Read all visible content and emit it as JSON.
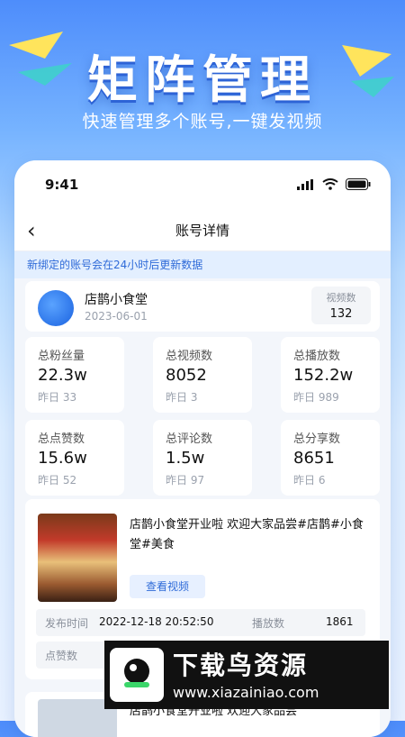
{
  "hero": {
    "title": "矩阵管理",
    "subtitle": "快速管理多个账号,一键发视频"
  },
  "status_bar": {
    "time": "9:41"
  },
  "navbar": {
    "title": "账号详情",
    "back_icon": "chevron-left-icon"
  },
  "notice": "新绑定的账号会在24小时后更新数据",
  "account": {
    "name": "店鹊小食堂",
    "date": "2023-06-01",
    "video_count_label": "视频数",
    "video_count": "132"
  },
  "stats": [
    {
      "label": "总粉丝量",
      "value": "22.3w",
      "sub": "昨日 33"
    },
    {
      "label": "总视频数",
      "value": "8052",
      "sub": "昨日 3"
    },
    {
      "label": "总播放数",
      "value": "152.2w",
      "sub": "昨日 989"
    },
    {
      "label": "总点赞数",
      "value": "15.6w",
      "sub": "昨日 52"
    },
    {
      "label": "总评论数",
      "value": "1.5w",
      "sub": "昨日 97"
    },
    {
      "label": "总分享数",
      "value": "8651",
      "sub": "昨日 6"
    }
  ],
  "video": {
    "description": "店鹊小食堂开业啦 欢迎大家品尝#店鹊#小食堂#美食",
    "view_button": "查看视频",
    "publish_label": "发布时间",
    "publish_time": "2022-12-18 20:52:50",
    "plays_label": "播放数",
    "plays": "1861",
    "likes_label": "点赞数"
  },
  "video2": {
    "description": "店鹊小食堂开业啦 欢迎大家品尝"
  },
  "watermark": {
    "brand": "下载鸟资源",
    "url": "www.xiazainiao.com"
  }
}
